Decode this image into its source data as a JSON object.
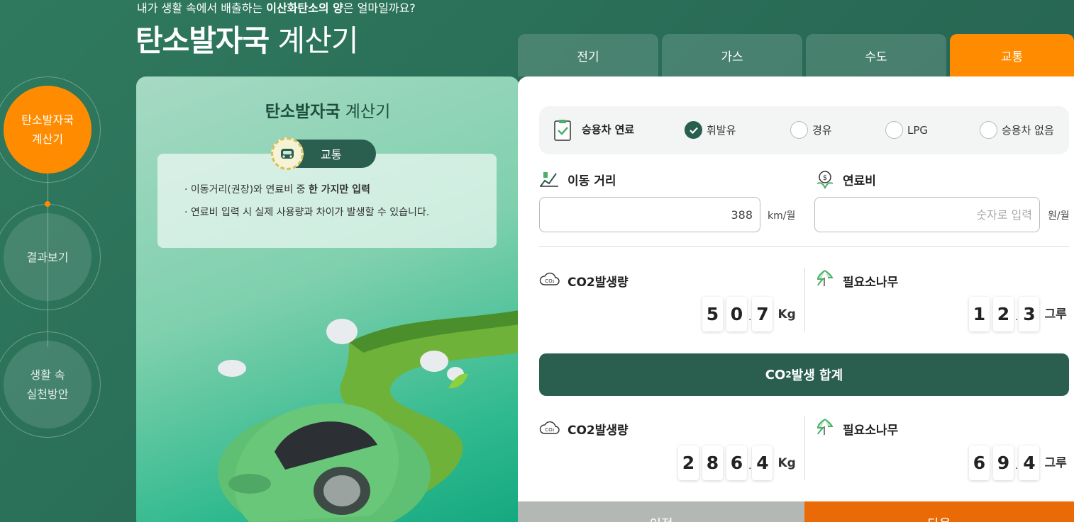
{
  "header": {
    "subtitle_pre": "내가 생활 속에서 배출하는 ",
    "subtitle_bold": "이산화탄소의 양",
    "subtitle_post": "은 얼마일까요?",
    "title_bold": "탄소발자국",
    "title_light": " 계산기"
  },
  "side_nav": [
    {
      "label": "탄소발자국\n계산기"
    },
    {
      "label": "결과보기"
    },
    {
      "label": "생활 속\n실천방안"
    }
  ],
  "left_card": {
    "title_bold": "탄소발자국",
    "title_light": " 계산기",
    "badge": "교통",
    "info_1_pre": "이동거리(권장)와 연료비 중 ",
    "info_1_bold": "한 가지만 입력",
    "info_2": "연료비 입력 시 실제 사용량과 차이가 발생할 수 있습니다."
  },
  "tabs": [
    {
      "label": "전기"
    },
    {
      "label": "가스"
    },
    {
      "label": "수도"
    },
    {
      "label": "교통"
    }
  ],
  "fuel": {
    "label": "승용차 연료",
    "options": [
      "휘발유",
      "경유",
      "LPG",
      "승용차 없음"
    ],
    "selected": "휘발유"
  },
  "distance": {
    "label": "이동 거리",
    "value": "388",
    "unit": "km/월"
  },
  "fuel_cost": {
    "label": "연료비",
    "placeholder": "숫자로 입력",
    "unit": "원/월"
  },
  "result_monthly": {
    "co2_label": "CO2발생량",
    "co2_digits": [
      "5",
      "0",
      "7"
    ],
    "co2_unit": "Kg",
    "tree_label": "필요소나무",
    "tree_digits": [
      "1",
      "2",
      "3"
    ],
    "tree_unit": "그루"
  },
  "total_bar": {
    "co": "CO",
    "sub": "2",
    "rest": " 발생 합계"
  },
  "result_total": {
    "co2_label": "CO2발생량",
    "co2_digits": [
      "2",
      "8",
      "6",
      "4"
    ],
    "co2_unit": "Kg",
    "tree_label": "필요소나무",
    "tree_digits": [
      "6",
      "9",
      "4"
    ],
    "tree_unit": "그루"
  },
  "buttons": {
    "prev": "이전",
    "next": "다음"
  },
  "colors": {
    "accent": "#ff8c00",
    "primary": "#2a5e4f",
    "next": "#ea6a06",
    "prev": "#b3b8b5"
  }
}
